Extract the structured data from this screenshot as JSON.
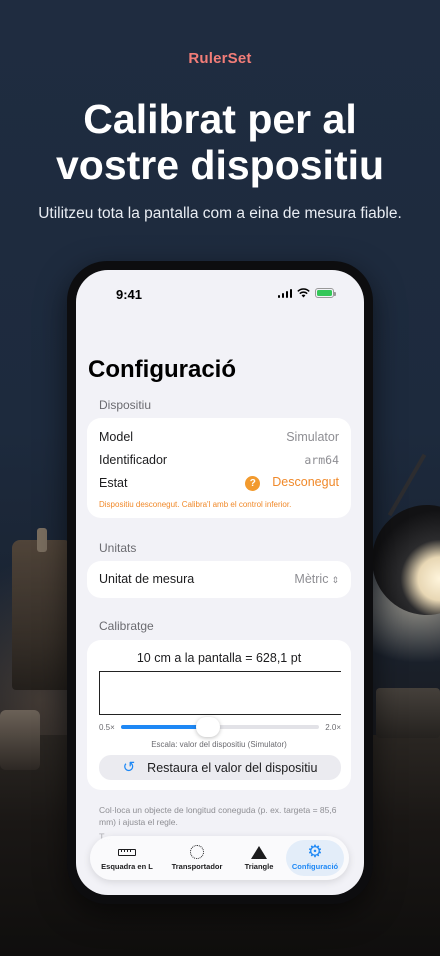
{
  "marketing": {
    "brand": "RulerSet",
    "headline_line1": "Calibrat per al",
    "headline_line2": "vostre dispositiu",
    "subline": "Utilitzeu tota la pantalla com a eina de mesura fiable."
  },
  "status_bar": {
    "time": "9:41"
  },
  "screen": {
    "title": "Configuració",
    "device_section": {
      "header": "Dispositiu",
      "model_label": "Model",
      "model_value": "Simulator",
      "identifier_label": "Identificador",
      "identifier_value": "arm64",
      "status_label": "Estat",
      "status_icon_glyph": "?",
      "status_value": "Desconegut",
      "warning": "Dispositiu desconegut. Calibra'l amb el control inferior."
    },
    "units_section": {
      "header": "Unitats",
      "unit_label": "Unitat de mesura",
      "unit_value": "Mètric"
    },
    "calibration_section": {
      "header": "Calibratge",
      "measure_text": "10 cm a la pantalla = 628,1 pt",
      "slider_min": "0.5×",
      "slider_max": "2.0×",
      "slider_fraction": 0.44,
      "scale_note": "Escala: valor del dispositiu (Simulator)",
      "restore_label": "Restaura el valor del dispositiu",
      "footnote": "Col·loca un objecte de longitud coneguda (p. ex. targeta = 85,6 mm) i ajusta el regle.",
      "faded_text": "T..."
    },
    "tabs": [
      {
        "label": "Esquadra en L",
        "icon": "ruler-icon"
      },
      {
        "label": "Transportador",
        "icon": "protractor-icon"
      },
      {
        "label": "Triangle",
        "icon": "triangle-icon"
      },
      {
        "label": "Configuració",
        "icon": "gear-icon",
        "active": true
      }
    ]
  },
  "colors": {
    "brand": "#f27d78",
    "accent": "#1e88f5",
    "warning": "#f0892a"
  }
}
